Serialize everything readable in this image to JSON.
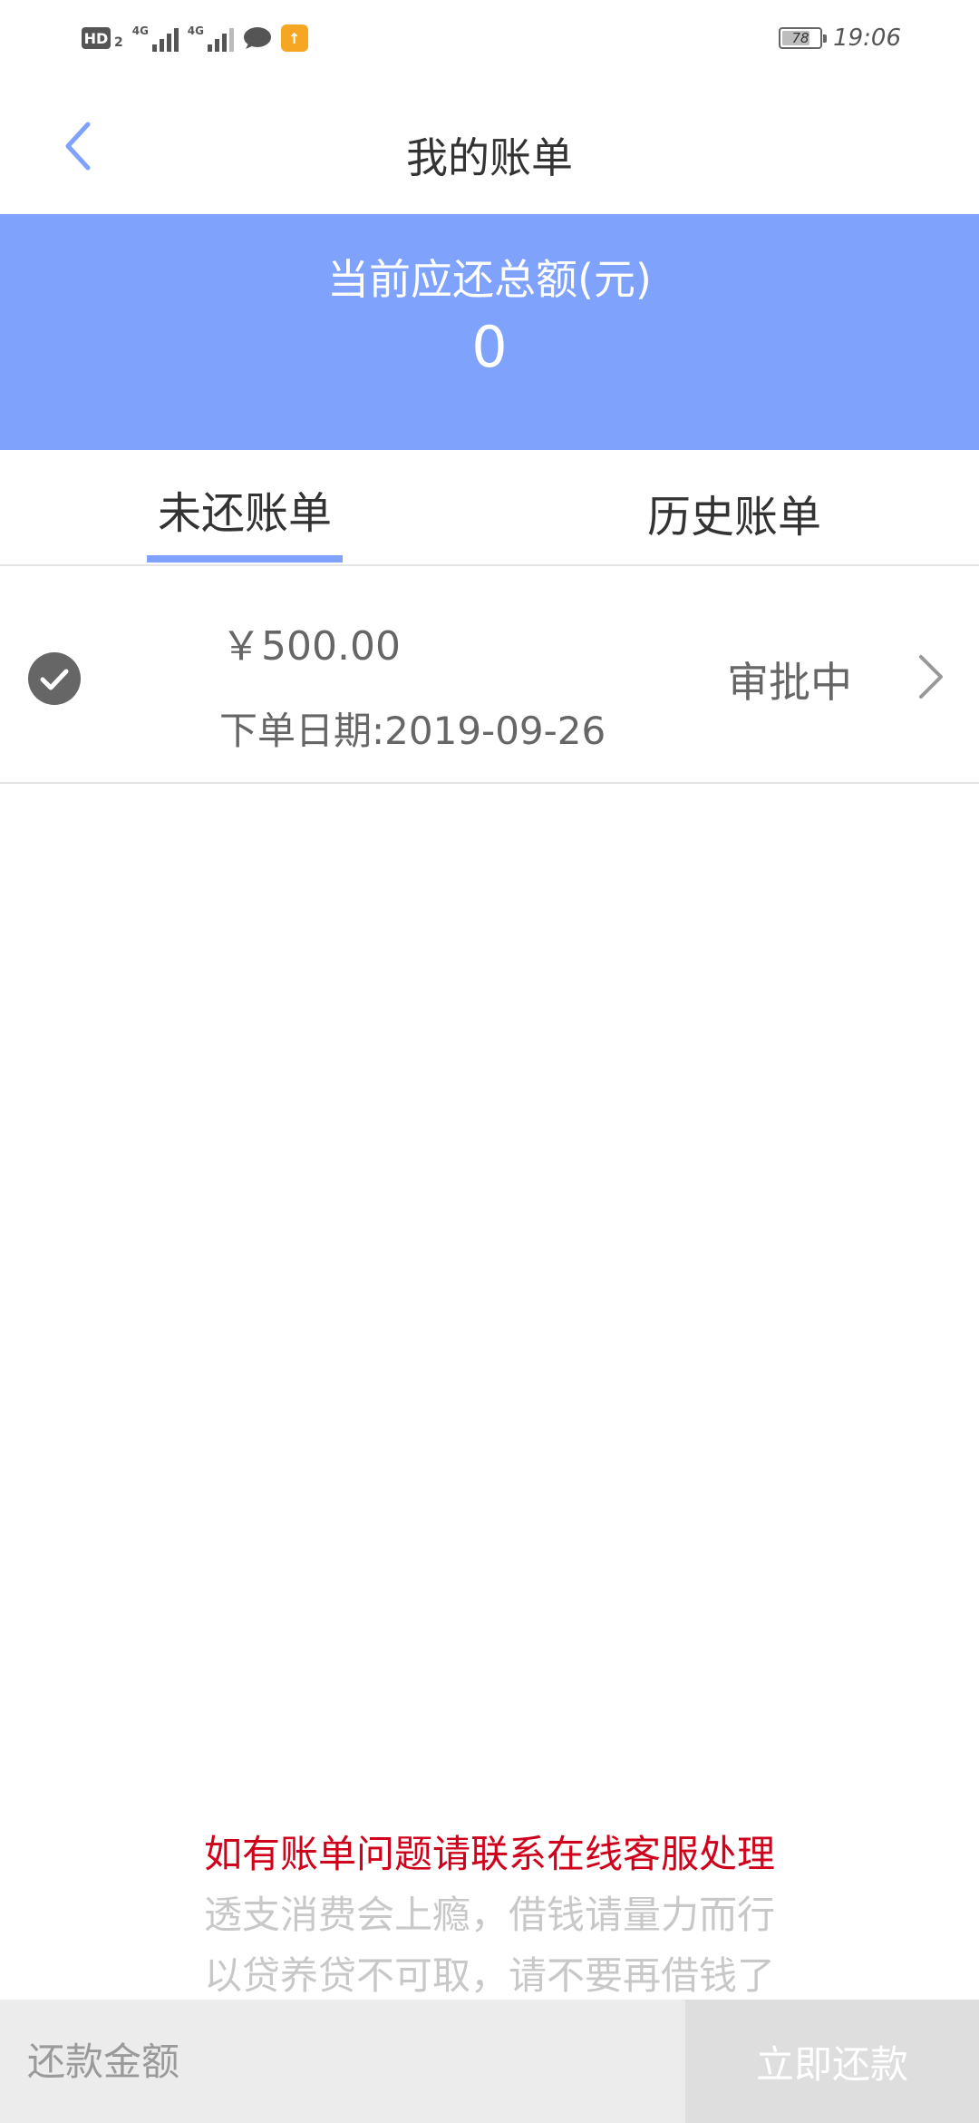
{
  "status_bar": {
    "hd_label": "HD",
    "hd_sub": "2",
    "sim1_network": "4G",
    "sim2_network": "4G",
    "battery_level": "78",
    "battery_fraction": 0.78,
    "time": "19:06",
    "icons": [
      "hd-icon",
      "signal-icon",
      "signal-icon",
      "chat-icon",
      "app-notification-icon",
      "battery-icon"
    ]
  },
  "nav": {
    "back_icon": "chevron-left-icon",
    "title": "我的账单"
  },
  "summary": {
    "label": "当前应还总额(元)",
    "amount": "0"
  },
  "tabs": [
    {
      "label": "未还账单",
      "active": true
    },
    {
      "label": "历史账单",
      "active": false
    }
  ],
  "bills": [
    {
      "icon": "check-circle-icon",
      "amount": "￥500.00",
      "date": "下单日期:2019-09-26",
      "status": "审批中",
      "arrow_icon": "chevron-right-icon"
    }
  ],
  "notices": {
    "contact": "如有账单问题请联系在线客服处理",
    "warning1": "透支消费会上瘾，借钱请量力而行",
    "warning2": "以贷养贷不可取，请不要再借钱了"
  },
  "footer": {
    "amount_placeholder": "还款金额",
    "pay_label": "立即还款"
  },
  "colors": {
    "accent": "#7fa3fc",
    "notice_red": "#d0021b",
    "notice_gray": "#c8c8c8",
    "input_bg": "#ececec",
    "button_disabled_bg": "#dedede"
  }
}
